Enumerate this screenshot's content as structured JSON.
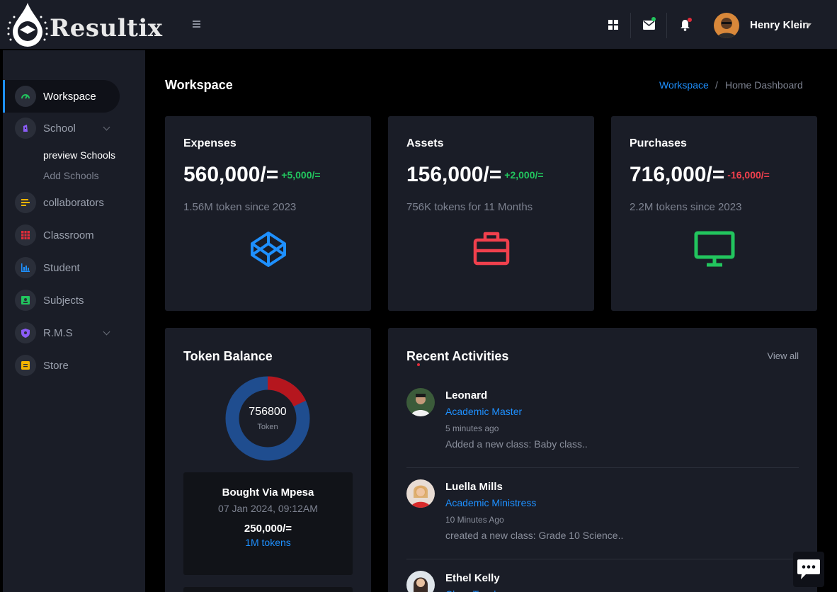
{
  "brand": {
    "name": "Resultix"
  },
  "topbar": {
    "user_name": "Henry Klein",
    "icons": [
      "grid-icon",
      "mail-icon",
      "bell-icon"
    ],
    "mail_dot_color": "#22c55e",
    "bell_dot_color": "#e02c3a"
  },
  "sidebar": {
    "items": [
      {
        "label": "Workspace",
        "icon": "speedometer-icon",
        "color": "#22c55e",
        "active": true
      },
      {
        "label": "School",
        "icon": "robot-icon",
        "color": "#8b5cf6",
        "expandable": true
      },
      {
        "label": "collaborators",
        "icon": "list-icon",
        "color": "#f5b400"
      },
      {
        "label": "Classroom",
        "icon": "table-icon",
        "color": "#e02c3a"
      },
      {
        "label": "Student",
        "icon": "chart-icon",
        "color": "#1e90ff"
      },
      {
        "label": "Subjects",
        "icon": "contact-icon",
        "color": "#22c55e"
      },
      {
        "label": "R.M.S",
        "icon": "shield-icon",
        "color": "#8b5cf6",
        "expandable": true
      },
      {
        "label": "Store",
        "icon": "note-icon",
        "color": "#f5b400"
      }
    ],
    "school_sub": [
      "preview Schools",
      "Add Schools"
    ]
  },
  "page": {
    "title": "Workspace",
    "breadcrumb": [
      "Workspace",
      "Home Dashboard"
    ]
  },
  "stats": [
    {
      "title": "Expenses",
      "value": "560,000/=",
      "delta": "+5,000/=",
      "delta_color": "#22c55e",
      "sub": "1.56M token since 2023",
      "icon": "codepen-icon",
      "icon_color": "#1e90ff"
    },
    {
      "title": "Assets",
      "value": "156,000/=",
      "delta": "+2,000/=",
      "delta_color": "#22c55e",
      "sub": "756K tokens for 11 Months",
      "icon": "briefcase-icon",
      "icon_color": "#f0404d"
    },
    {
      "title": "Purchases",
      "value": "716,000/=",
      "delta": "-16,000/=",
      "delta_color": "#f0404d",
      "sub": "2.2M tokens since 2023",
      "icon": "monitor-icon",
      "icon_color": "#22c55e"
    }
  ],
  "token": {
    "title": "Token Balance",
    "value": "756800",
    "label": "Token",
    "spent_fraction": 0.18,
    "colors": {
      "main": "#1f4d8f",
      "spent": "#b5161e"
    },
    "transaction": {
      "title": "Bought Via Mpesa",
      "date": "07 Jan 2024, 09:12AM",
      "amount": "250,000/=",
      "tokens": "1M tokens"
    }
  },
  "activities": {
    "title": "Recent Activities",
    "view_all": "View all",
    "items": [
      {
        "name": "Leonard",
        "role": "Academic Master",
        "time": "5 minutes ago",
        "desc": "Added a new class: Baby class.."
      },
      {
        "name": "Luella Mills",
        "role": "Academic Ministress",
        "time": "10 Minutes Ago",
        "desc": "created a new class: Grade 10 Science.."
      },
      {
        "name": "Ethel Kelly",
        "role": "Class Teacher",
        "time": "",
        "desc": ""
      }
    ]
  }
}
